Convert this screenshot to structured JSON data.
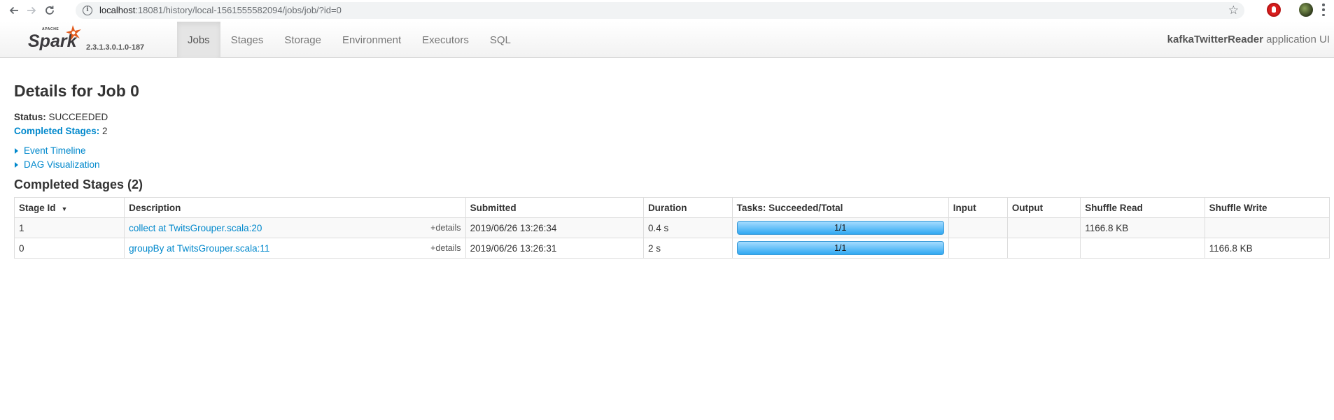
{
  "browser": {
    "url_host": "localhost",
    "url_rest": ":18081/history/local-1561555582094/jobs/job/?id=0",
    "icons": [
      "back-icon",
      "forward-icon",
      "reload-icon",
      "info-icon",
      "star-icon",
      "extension-icon",
      "profile-avatar",
      "menu-icon"
    ]
  },
  "navbar": {
    "logo_text": "Spark",
    "logo_apache": "APACHE",
    "version": "2.3.1.3.0.1.0-187",
    "tabs": [
      {
        "label": "Jobs",
        "active": true
      },
      {
        "label": "Stages",
        "active": false
      },
      {
        "label": "Storage",
        "active": false
      },
      {
        "label": "Environment",
        "active": false
      },
      {
        "label": "Executors",
        "active": false
      },
      {
        "label": "SQL",
        "active": false
      }
    ],
    "app_name": "kafkaTwitterReader",
    "app_suffix": " application UI"
  },
  "page": {
    "title": "Details for Job 0",
    "status_label": "Status:",
    "status_value": "SUCCEEDED",
    "completed_stages_label": "Completed Stages:",
    "completed_stages_value": "2",
    "event_timeline": "Event Timeline",
    "dag_visualization": "DAG Visualization",
    "section_title": "Completed Stages (2)"
  },
  "table": {
    "headers": {
      "stage_id": "Stage Id",
      "description": "Description",
      "submitted": "Submitted",
      "duration": "Duration",
      "tasks": "Tasks: Succeeded/Total",
      "input": "Input",
      "output": "Output",
      "shuffle_read": "Shuffle Read",
      "shuffle_write": "Shuffle Write"
    },
    "details_label": "+details",
    "rows": [
      {
        "stage_id": "1",
        "description": "collect at TwitsGrouper.scala:20",
        "submitted": "2019/06/26 13:26:34",
        "duration": "0.4 s",
        "tasks": "1/1",
        "tasks_fraction": 1.0,
        "input": "",
        "output": "",
        "shuffle_read": "1166.8 KB",
        "shuffle_write": ""
      },
      {
        "stage_id": "0",
        "description": "groupBy at TwitsGrouper.scala:11",
        "submitted": "2019/06/26 13:26:31",
        "duration": "2 s",
        "tasks": "1/1",
        "tasks_fraction": 1.0,
        "input": "",
        "output": "",
        "shuffle_read": "",
        "shuffle_write": "1166.8 KB"
      }
    ]
  }
}
